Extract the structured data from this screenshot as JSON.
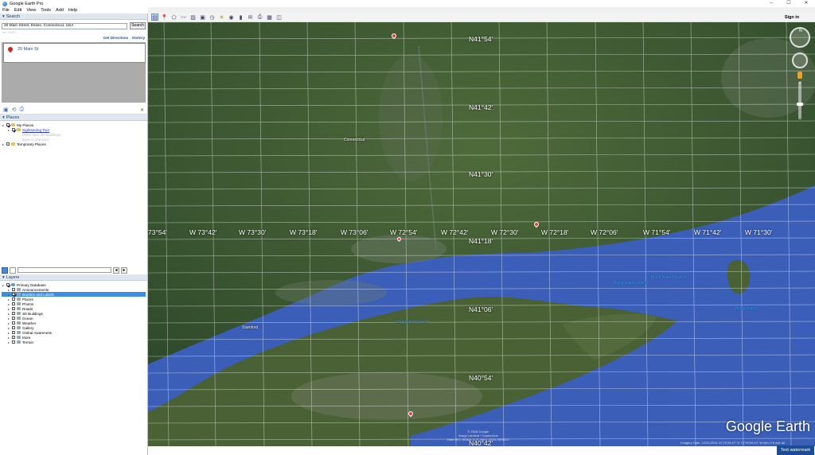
{
  "window": {
    "title": "Google Earth Pro",
    "controls": [
      "–",
      "☐",
      "✕"
    ]
  },
  "menu": [
    "File",
    "Edit",
    "View",
    "Tools",
    "Add",
    "Help"
  ],
  "toolbar": {
    "icons": [
      "sidebar-icon",
      "placemark-icon",
      "polygon-icon",
      "path-icon",
      "image-overlay-icon",
      "record-tour-icon",
      "historical-imagery-icon",
      "sun-icon",
      "planets-icon",
      "ruler-icon",
      "email-icon",
      "print-icon",
      "save-image-icon",
      "view-in-maps-icon"
    ]
  },
  "signin": "Sign in",
  "search": {
    "header": "Search",
    "value": "20 Main Street, Essex, Connecticut, USA",
    "button": "Search",
    "hint": "ex: 10023",
    "get_directions": "Get Directions",
    "history": "History",
    "result_name": "20 Main St"
  },
  "places": {
    "header": "Places",
    "items": [
      {
        "label": "My Places",
        "level": 0,
        "checked": true,
        "icon": "folder"
      },
      {
        "label": "Sightseeing Tour",
        "level": 1,
        "checked": true,
        "icon": "folder",
        "link": true
      },
      {
        "label": "Make sure 3D Buildings",
        "level": 2,
        "faint": true
      },
      {
        "label": "layer is checked",
        "level": 2,
        "faint": true
      },
      {
        "label": "Temporary Places",
        "level": 0,
        "checked": false,
        "icon": "folder"
      }
    ]
  },
  "layers": {
    "header": "Layers",
    "items": [
      {
        "label": "Primary Database",
        "level": 0,
        "checked": true,
        "icon": "globe"
      },
      {
        "label": "Announcements",
        "level": 1,
        "checked": false,
        "icon": "gray"
      },
      {
        "label": "Borders and Labels",
        "level": 1,
        "checked": true,
        "icon": "gray",
        "selected": true
      },
      {
        "label": "Places",
        "level": 1,
        "checked": false,
        "icon": "gray"
      },
      {
        "label": "Photos",
        "level": 1,
        "checked": false,
        "icon": "gray"
      },
      {
        "label": "Roads",
        "level": 1,
        "checked": false,
        "icon": "gray"
      },
      {
        "label": "3D Buildings",
        "level": 1,
        "checked": false,
        "icon": "gray"
      },
      {
        "label": "Ocean",
        "level": 1,
        "checked": false,
        "icon": "gray"
      },
      {
        "label": "Weather",
        "level": 1,
        "checked": false,
        "icon": "gray"
      },
      {
        "label": "Gallery",
        "level": 1,
        "checked": false,
        "icon": "gray"
      },
      {
        "label": "Global Awareness",
        "level": 1,
        "checked": false,
        "icon": "gray"
      },
      {
        "label": "More",
        "level": 1,
        "checked": false,
        "icon": "gray"
      },
      {
        "label": "Terrain",
        "level": 1,
        "checked": false,
        "icon": "gray"
      }
    ]
  },
  "map": {
    "lat_labels": [
      "N41°54'",
      "N41°42'",
      "N41°30'",
      "N41°18'",
      "N41°06'",
      "N40°54'",
      "N40°42'"
    ],
    "lon_labels": [
      "73°54'",
      "W 73°42'",
      "W 73°30'",
      "W 73°18'",
      "W 73°06'",
      "W 72°54'",
      "W 72°42'",
      "W 72°30'",
      "W 72°18'",
      "W 72°06'",
      "W 71°54'",
      "W 71°42'",
      "W 71°30'"
    ],
    "places": [
      "Connecticut",
      "Stamford"
    ],
    "water": [
      "Long Island Sound",
      "Block Island Sound",
      "Block Island Sound",
      "Block Island"
    ],
    "logo": "Google Earth",
    "credits_1": "© 2018 Google",
    "credits_2": "Image Landsat / Copernicus",
    "credits_3": "Data SIO, NOAA, U.S. Navy, NGA, GEBCO",
    "imagery_date": "Imagery Date: 12/31/2015   41°19'49.47\" N  72°49'53.43\" W  elev  0 ft    eye alt",
    "compass_n": "N",
    "colors": {
      "land": "#3f5e33",
      "water": "#3b5fb8",
      "grid": "#ffffff",
      "pin": "#e84040"
    }
  },
  "watermark_button": "Text watermark"
}
